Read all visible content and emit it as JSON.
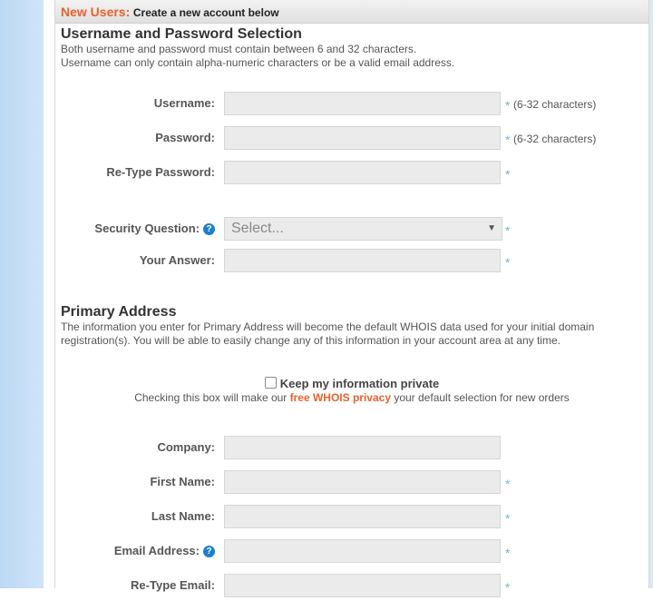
{
  "header": {
    "accent": "New Users:",
    "text": "Create a new account below"
  },
  "credentials": {
    "title": "Username and Password Selection",
    "desc_line1": "Both username and password must contain between 6 and 32 characters.",
    "desc_line2": "Username can only contain alpha-numeric characters or be a valid email address.",
    "username_label": "Username:",
    "password_label": "Password:",
    "retype_password_label": "Re-Type Password:",
    "length_hint": "(6-32 characters)",
    "security_question_label": "Security Question:",
    "security_question_value": "Select...",
    "answer_label": "Your Answer:",
    "required_mark": "*"
  },
  "address": {
    "title": "Primary Address",
    "desc": "The information you enter for Primary Address will become the default WHOIS data used for your initial domain registration(s). You will be able to easily change any of this information in your account area at any time.",
    "privacy_label": "Keep my information private",
    "privacy_note_before": "Checking this box will make our ",
    "privacy_link": "free WHOIS privacy",
    "privacy_note_after": " your default selection for new orders",
    "company_label": "Company:",
    "first_name_label": "First Name:",
    "last_name_label": "Last Name:",
    "email_label": "Email Address:",
    "retype_email_label": "Re-Type Email:"
  },
  "help_icon_text": "?",
  "select_arrow": "▼",
  "colors": {
    "accent": "#e8612c",
    "required": "#69b4e6",
    "help": "#1b7fd1"
  }
}
